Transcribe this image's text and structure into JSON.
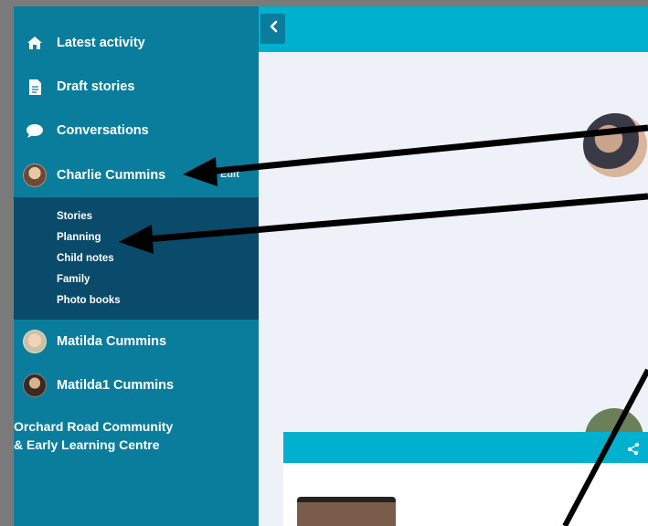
{
  "sidebar": {
    "items": [
      {
        "label": "Latest activity",
        "icon": "home-icon"
      },
      {
        "label": "Draft stories",
        "icon": "document-icon"
      },
      {
        "label": "Conversations",
        "icon": "chat-bubble-icon"
      }
    ],
    "child": {
      "name": "Charlie Cummins",
      "edit_label": "Edit",
      "submenu": [
        "Stories",
        "Planning",
        "Child notes",
        "Family",
        "Photo books"
      ]
    },
    "other_children": [
      {
        "name": "Matilda Cummins"
      },
      {
        "name": "Matilda1 Cummins"
      }
    ],
    "centre": {
      "line1": "Orchard Road Community",
      "line2": "& Early Learning Centre"
    }
  },
  "colors": {
    "sidebar": "#0a7d9c",
    "submenu": "#0a4a6a",
    "topbar": "#00b0cf",
    "content": "#eef2f8",
    "annotation": "#000000"
  }
}
